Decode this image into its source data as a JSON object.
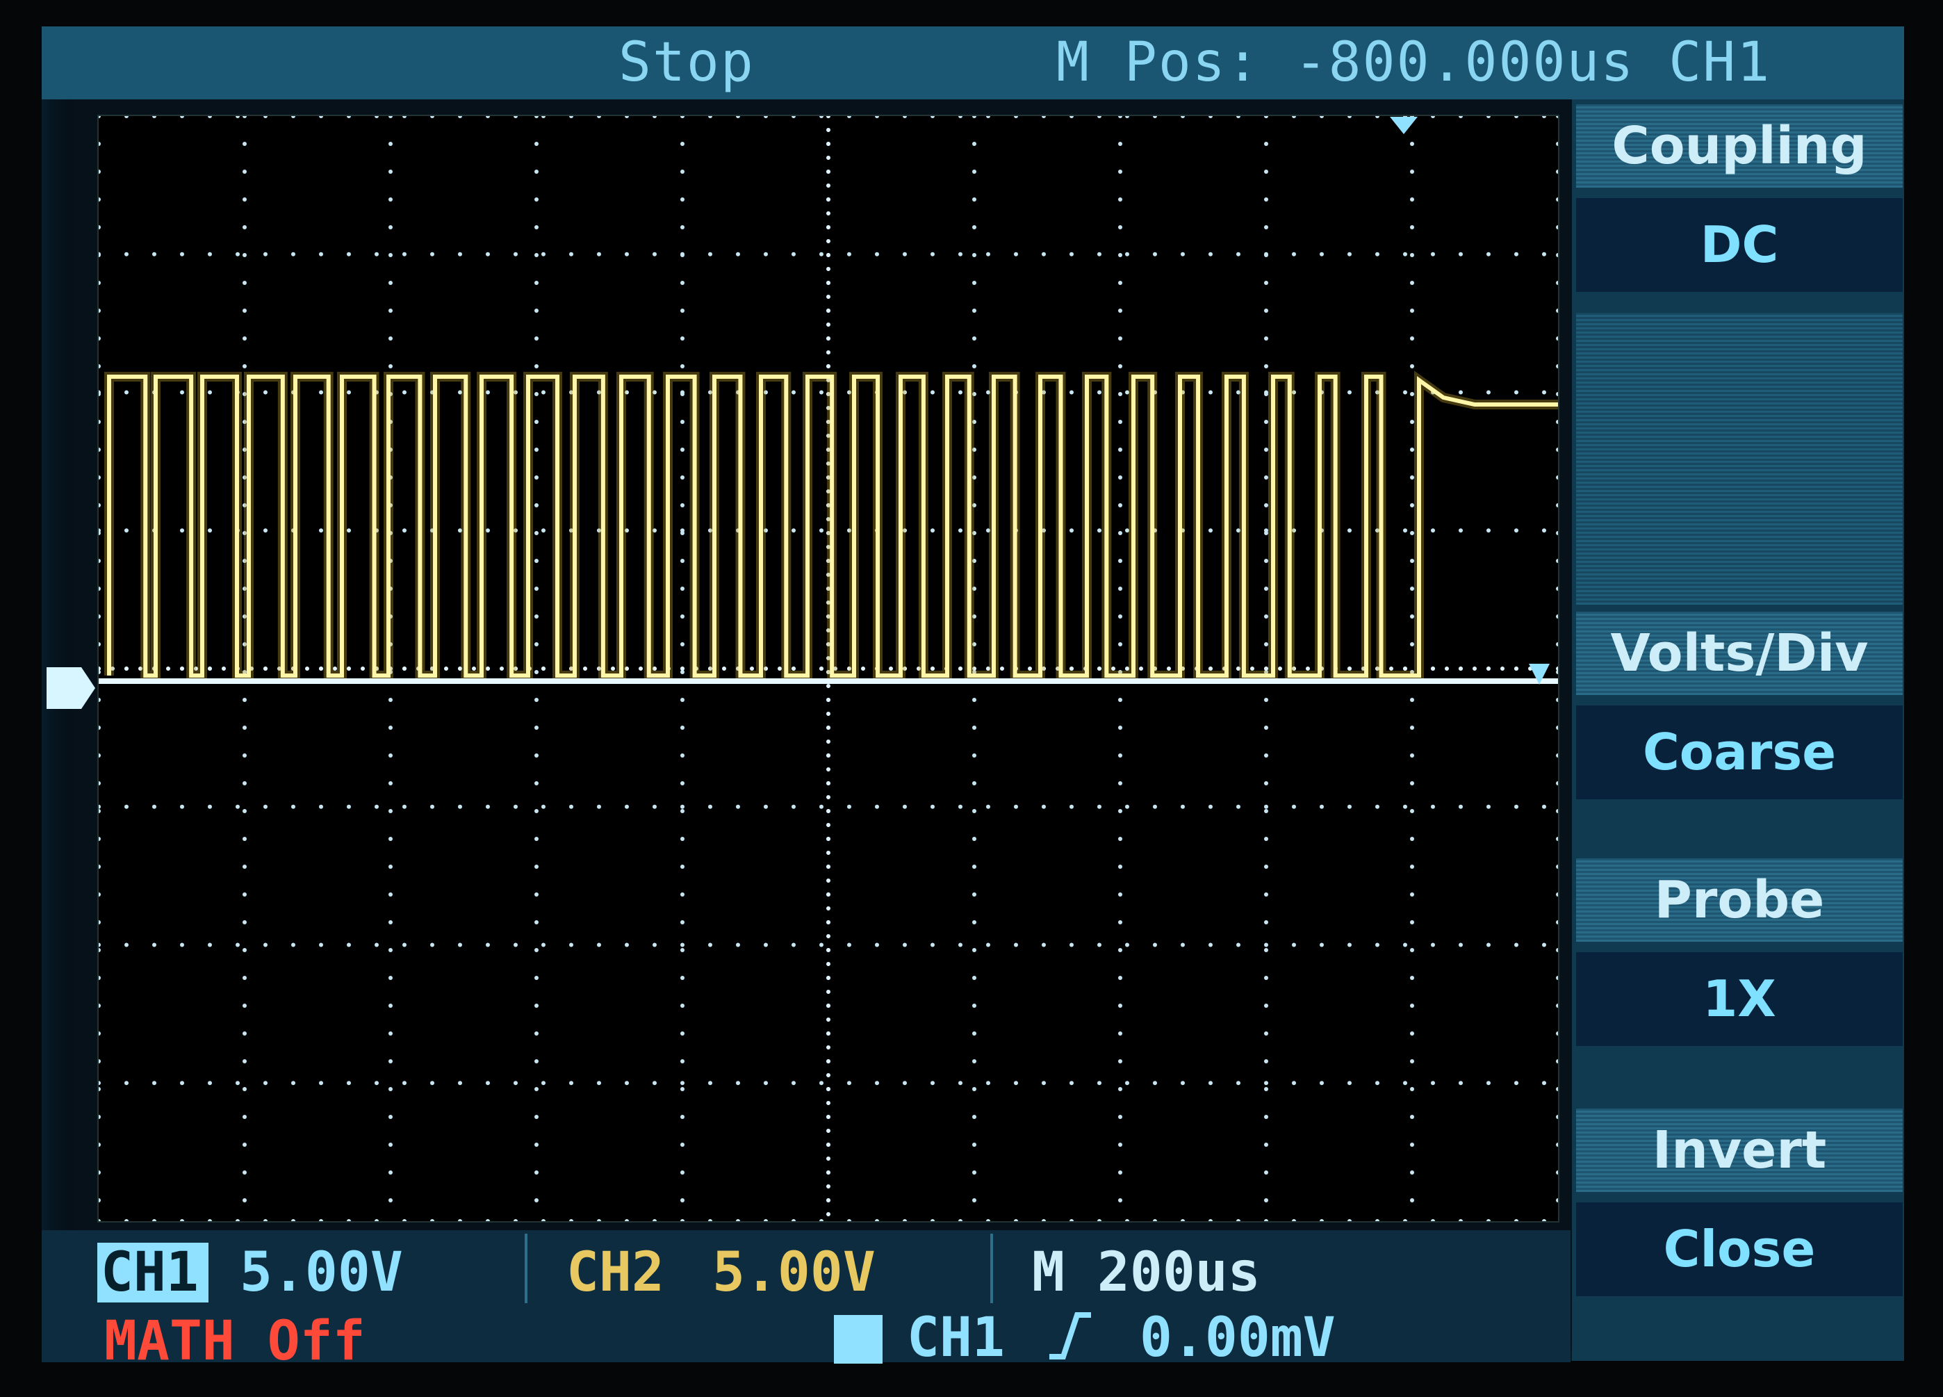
{
  "top": {
    "status": "Stop",
    "mpos": "M Pos: -800.000us CH1"
  },
  "menu": [
    {
      "title": "Coupling",
      "value": "DC"
    },
    {
      "title": "Volts/Div",
      "value": "Coarse"
    },
    {
      "title": "Probe",
      "value": "1X"
    },
    {
      "title": "Invert",
      "value": "Close"
    }
  ],
  "bottom": {
    "ch1_label": "CH1",
    "ch1_scale": "5.00V",
    "ch2_label": "CH2",
    "ch2_scale": "5.00V",
    "timebase": "M 200us",
    "math": "MATH Off",
    "trig_source": "CH1",
    "trig_level": "0.00mV"
  },
  "colors": {
    "ch1": "#fff6a8",
    "ch2": "#e8c860",
    "accent": "#7fe0ff",
    "math": "#ff4a3a"
  }
}
